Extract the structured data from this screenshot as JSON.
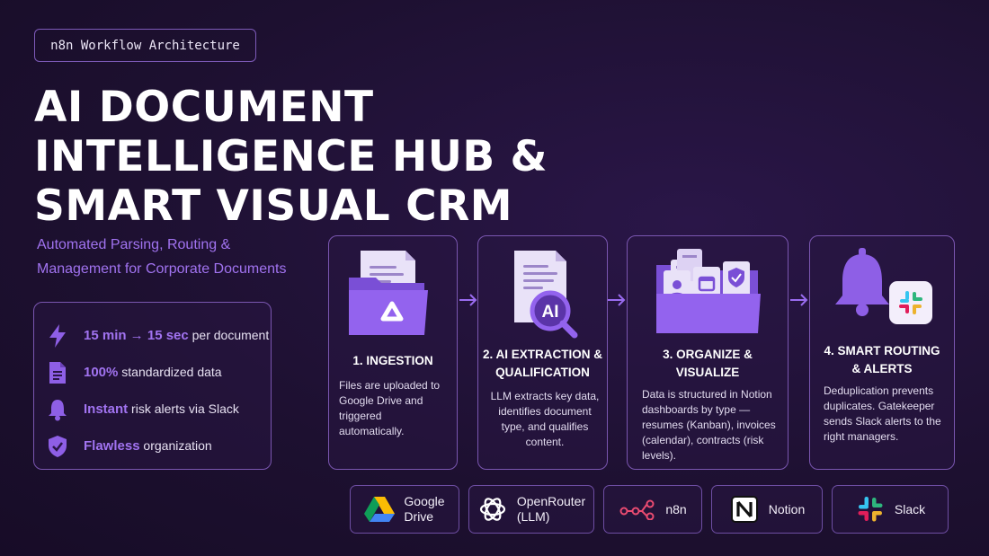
{
  "badge": "n8n Workflow Architecture",
  "title": [
    "AI DOCUMENT",
    "INTELLIGENCE HUB &",
    "SMART VISUAL CRM"
  ],
  "subtitle": [
    "Automated Parsing, Routing &",
    "Management for Corporate Documents"
  ],
  "stats": [
    {
      "icon": "lightning-icon",
      "highlight": "15 min → 15 sec",
      "text": " per document"
    },
    {
      "icon": "document-icon",
      "highlight": "100%",
      "text": " standardized data"
    },
    {
      "icon": "bell-icon",
      "highlight": "Instant",
      "text": " risk alerts via Slack"
    },
    {
      "icon": "shield-check-icon",
      "highlight": "Flawless",
      "text": " organization"
    }
  ],
  "steps": [
    {
      "title": "1. INGESTION",
      "description": "Files are uploaded to Google Drive and triggered automatically.",
      "icon": "drive-folder-icon"
    },
    {
      "title": "2. AI EXTRACTION & QUALIFICATION",
      "description": "LLM extracts key data, identifies document type, and qualifies content.",
      "icon": "ai-magnifier-icon"
    },
    {
      "title": "3. ORGANIZE & VISUALIZE",
      "description": "Data is structured in Notion dashboards by type — resumes (Kanban), invoices (calendar), contracts (risk levels).",
      "icon": "folder-cards-icon"
    },
    {
      "title": "4. SMART ROUTING & ALERTS",
      "description": "Deduplication prevents duplicates. Gatekeeper sends Slack alerts to the right managers.",
      "icon": "bell-slack-icon"
    }
  ],
  "tools": [
    {
      "name": "Google\nDrive",
      "icon": "google-drive-icon"
    },
    {
      "name": "OpenRouter\n(LLM)",
      "icon": "openrouter-icon"
    },
    {
      "name": "n8n",
      "icon": "n8n-icon"
    },
    {
      "name": "Notion",
      "icon": "notion-icon"
    },
    {
      "name": "Slack",
      "icon": "slack-icon"
    }
  ],
  "colors": {
    "accent": "#a173f0",
    "border": "#7a56b0",
    "background": "#1d1030"
  }
}
